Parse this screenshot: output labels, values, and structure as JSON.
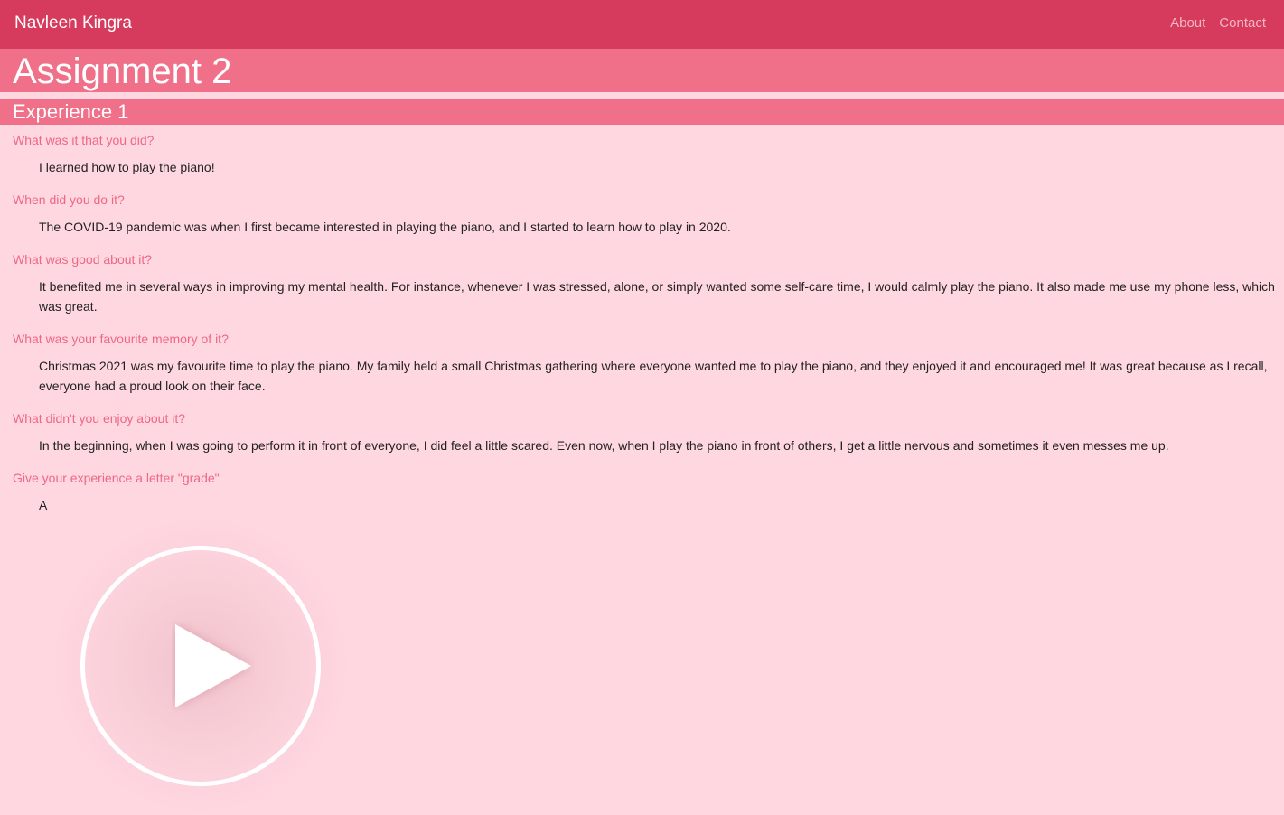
{
  "nav": {
    "brand": "Navleen Kingra",
    "links": [
      "About",
      "Contact"
    ]
  },
  "page": {
    "title": "Assignment 2"
  },
  "section": {
    "title": "Experience 1",
    "items": [
      {
        "question": "What was it that you did?",
        "answer": "I learned how to play the piano!"
      },
      {
        "question": "When did you do it?",
        "answer": "The COVID-19 pandemic was when I first became interested in playing the piano, and I started to learn how to play in 2020."
      },
      {
        "question": "What was good about it?",
        "answer": "It benefited me in several ways in improving my mental health. For instance, whenever I was stressed, alone, or simply wanted some self-care time, I would calmly play the piano. It also made me use my phone less, which was great."
      },
      {
        "question": "What was your favourite memory of it?",
        "answer": "Christmas 2021 was my favourite time to play the piano. My family held a small Christmas gathering where everyone wanted me to play the piano, and they enjoyed it and encouraged me! It was great because as I recall, everyone had a proud look on their face."
      },
      {
        "question": "What didn't you enjoy about it?",
        "answer": "In the beginning, when I was going to perform it in front of everyone, I did feel a little scared. Even now, when I play the piano in front of others, I get a little nervous and sometimes it even messes me up."
      },
      {
        "question": "Give your experience a letter \"grade\"",
        "answer": "A"
      }
    ]
  },
  "video": {
    "icon": "play-icon"
  },
  "colors": {
    "navbar": "#d63b5e",
    "title_bar": "#ef7088",
    "background": "#ffd7e0",
    "question_text": "#ef6784"
  }
}
